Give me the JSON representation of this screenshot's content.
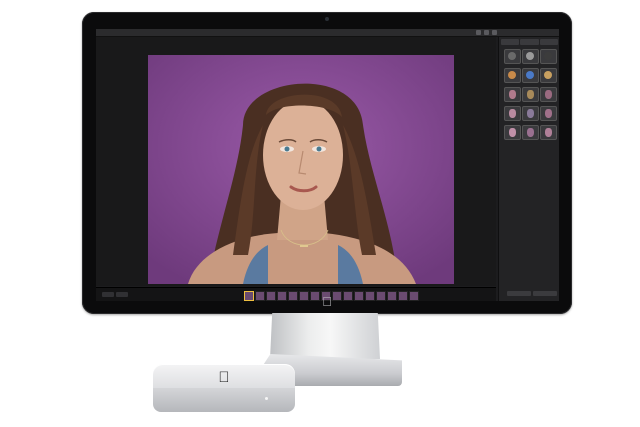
{
  "scene": {
    "monitor_logo_icon": "apple-logo-icon",
    "mini_logo_icon": "apple-logo-icon"
  },
  "app": {
    "window_title": "",
    "panel_tabs": [
      "",
      "",
      ""
    ],
    "presets": [
      {
        "kind": "dot",
        "color": "#6a6a6a"
      },
      {
        "kind": "dot",
        "color": "#9a9a9a"
      },
      {
        "kind": "dot",
        "color": "#3c3c3c"
      },
      {
        "kind": "dot",
        "color": "#c88a4a"
      },
      {
        "kind": "dot",
        "color": "#4a7ac8"
      },
      {
        "kind": "dot",
        "color": "#c8a060"
      },
      {
        "kind": "face",
        "color": "#b07a8c"
      },
      {
        "kind": "face",
        "color": "#a88a5a"
      },
      {
        "kind": "face",
        "color": "#9a6a80"
      },
      {
        "kind": "face",
        "color": "#b88aa0"
      },
      {
        "kind": "face",
        "color": "#8a7a9a"
      },
      {
        "kind": "face",
        "color": "#a0708a"
      },
      {
        "kind": "face",
        "color": "#c090a8"
      },
      {
        "kind": "face",
        "color": "#9a7090"
      },
      {
        "kind": "face",
        "color": "#b08098"
      }
    ],
    "filmstrip_count": 16,
    "photo_background": "#8b4d99"
  }
}
